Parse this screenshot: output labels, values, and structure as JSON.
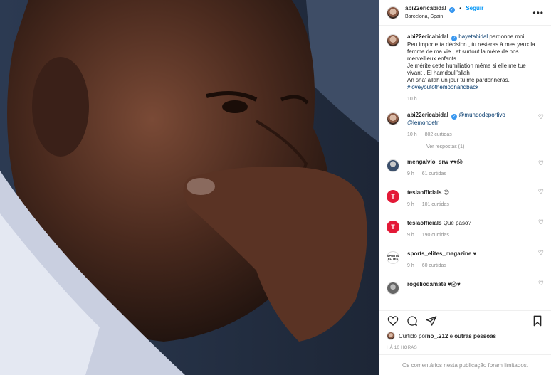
{
  "header": {
    "username": "abi22ericabidal",
    "follow": "Seguir",
    "dot": "•",
    "location": "Barcelona, Spain"
  },
  "caption": {
    "username": "abi22ericabidal",
    "mention": "hayetabidal",
    "text": " pardonne moi . Peu importe ta décision , tu resteras à mes yeux la femme de ma vie , et surtout la mère de nos merveilleux enfants.",
    "line2": "Je mérite cette humiliation même si elle me tue vivant . El hamdouli'allah",
    "line3": "An sha' allah un jour tu me pardonneras.",
    "hashtag": "#loveyoutothemoonandback",
    "time": "10 h"
  },
  "comments": [
    {
      "user": "abi22ericabidal",
      "mention1": "@mundodeportivo",
      "mention2": "@lemondefr",
      "time": "10 h",
      "likes": "802 curtidas",
      "replies": "Ver respostas (1)"
    },
    {
      "user": "mengalvio_srw",
      "text": "♥♥😱",
      "time": "9 h",
      "likes": "61 curtidas"
    },
    {
      "user": "teslaofficials",
      "text": "😉",
      "time": "9 h",
      "likes": "101 curtidas"
    },
    {
      "user": "teslaofficials",
      "text": "Que pasó?",
      "time": "9 h",
      "likes": "190 curtidas"
    },
    {
      "user": "sports_elites_magazine",
      "text": "♥",
      "time": "9 h",
      "likes": "60 curtidas"
    },
    {
      "user": "rogeliodamate",
      "text": "♥😱♥",
      "time": "",
      "likes": ""
    }
  ],
  "avatar_text": {
    "tesla": "T",
    "sports": "SPORTS ELITES"
  },
  "likes_line": {
    "prefix": "Curtido por ",
    "user": "no_.212",
    "suffix": " e ",
    "others": "outras pessoas"
  },
  "timestamp": "HÁ 10 HORAS",
  "limited": "Os comentários nesta publicação foram limitados.",
  "icons": {
    "heart": "heart-icon",
    "comment": "comment-icon",
    "share": "share-icon",
    "save": "bookmark-icon",
    "more": "more-icon"
  },
  "colors": {
    "link": "#0095f6",
    "verified": "#3897f0",
    "tesla": "#e31937",
    "muted": "#8e8e8e"
  }
}
